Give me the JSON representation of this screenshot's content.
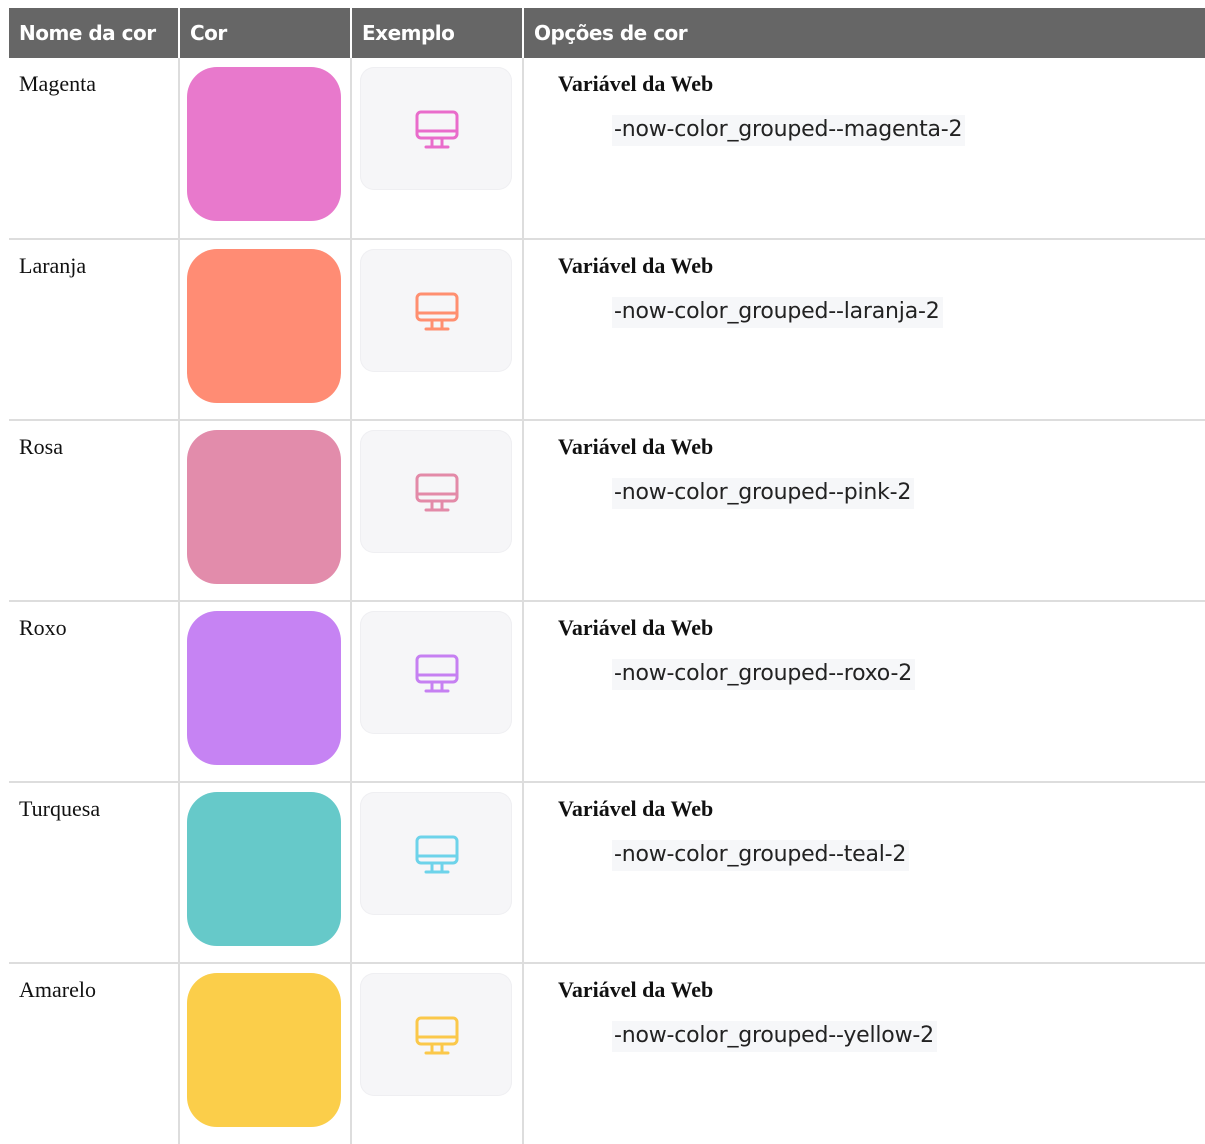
{
  "table": {
    "headers": {
      "name": "Nome da cor",
      "color": "Cor",
      "example": "Exemplo",
      "options": "Opções de cor"
    },
    "rows": [
      {
        "name": "Magenta",
        "swatch_color": "#e879cc",
        "icon": "monitor-icon",
        "icon_color": "#e96ccb",
        "web_label": "Variável da Web",
        "web_variable": "-now-color_grouped--magenta-2"
      },
      {
        "name": "Laranja",
        "swatch_color": "#ff8c74",
        "icon": "monitor-icon",
        "icon_color": "#ff8f70",
        "web_label": "Variável da Web",
        "web_variable": "-now-color_grouped--laranja-2"
      },
      {
        "name": "Rosa",
        "swatch_color": "#e28cab",
        "icon": "monitor-icon",
        "icon_color": "#e38aa8",
        "web_label": "Variável da Web",
        "web_variable": "-now-color_grouped--pink-2"
      },
      {
        "name": "Roxo",
        "swatch_color": "#c683f3",
        "icon": "monitor-icon",
        "icon_color": "#c680f2",
        "web_label": "Variável da Web",
        "web_variable": "-now-color_grouped--roxo-2"
      },
      {
        "name": "Turquesa",
        "swatch_color": "#66c9c9",
        "icon": "monitor-icon",
        "icon_color": "#6dd3ea",
        "web_label": "Variável da Web",
        "web_variable": "-now-color_grouped--teal-2"
      },
      {
        "name": "Amarelo",
        "swatch_color": "#fbce4a",
        "icon": "monitor-icon",
        "icon_color": "#fbc84a",
        "web_label": "Variável da Web",
        "web_variable": "-now-color_grouped--yellow-2"
      }
    ]
  }
}
